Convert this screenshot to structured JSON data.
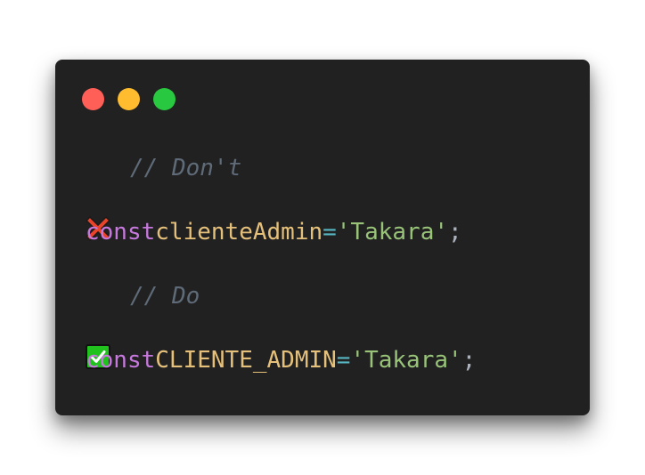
{
  "window": {
    "dots": [
      {
        "name": "close-dot",
        "color": "#ff5f57"
      },
      {
        "name": "minimize-dot",
        "color": "#febc2e"
      },
      {
        "name": "maximize-dot",
        "color": "#28c840"
      }
    ]
  },
  "code": {
    "dont": {
      "icon": "cross-mark-icon",
      "comment": "// Don't"
    },
    "line_bad": {
      "keyword": "const",
      "identifier": "clienteAdmin",
      "operator": "=",
      "string": "'Takara'",
      "terminator": ";"
    },
    "do": {
      "icon": "check-mark-icon",
      "comment": "// Do"
    },
    "line_good": {
      "keyword": "const",
      "identifier": "CLIENTE_ADMIN",
      "operator": "=",
      "string": "'Takara'",
      "terminator": ";"
    }
  },
  "colors": {
    "background": "#212121",
    "keyword": "#c678dd",
    "identifier": "#e5c07b",
    "operator": "#56b6c2",
    "string": "#98c379",
    "comment": "#5f6b78"
  }
}
